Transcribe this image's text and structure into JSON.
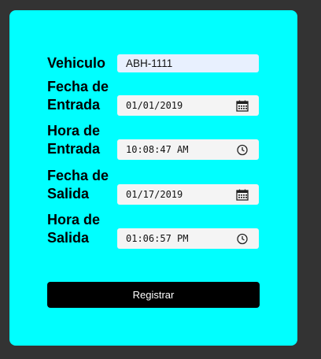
{
  "form": {
    "vehiculo": {
      "label": "Vehiculo",
      "value": "ABH-1111"
    },
    "fecha_entrada": {
      "label_line1": "Fecha de",
      "label_line2": "Entrada",
      "value": "01/01/2019",
      "icon": "calendar-icon"
    },
    "hora_entrada": {
      "label_line1": "Hora de",
      "label_line2": "Entrada",
      "value": "10:08:47 AM",
      "icon": "clock-icon"
    },
    "fecha_salida": {
      "label_line1": "Fecha de",
      "label_line2": "Salida",
      "value": "01/17/2019",
      "icon": "calendar-icon"
    },
    "hora_salida": {
      "label_line1": "Hora de",
      "label_line2": "Salida",
      "value": "01:06:57 PM",
      "icon": "clock-icon"
    },
    "submit_label": "Registrar"
  },
  "colors": {
    "page_background": "#333333",
    "card_background": "#00ffff",
    "button_background": "#000000",
    "button_text": "#ffffff"
  }
}
